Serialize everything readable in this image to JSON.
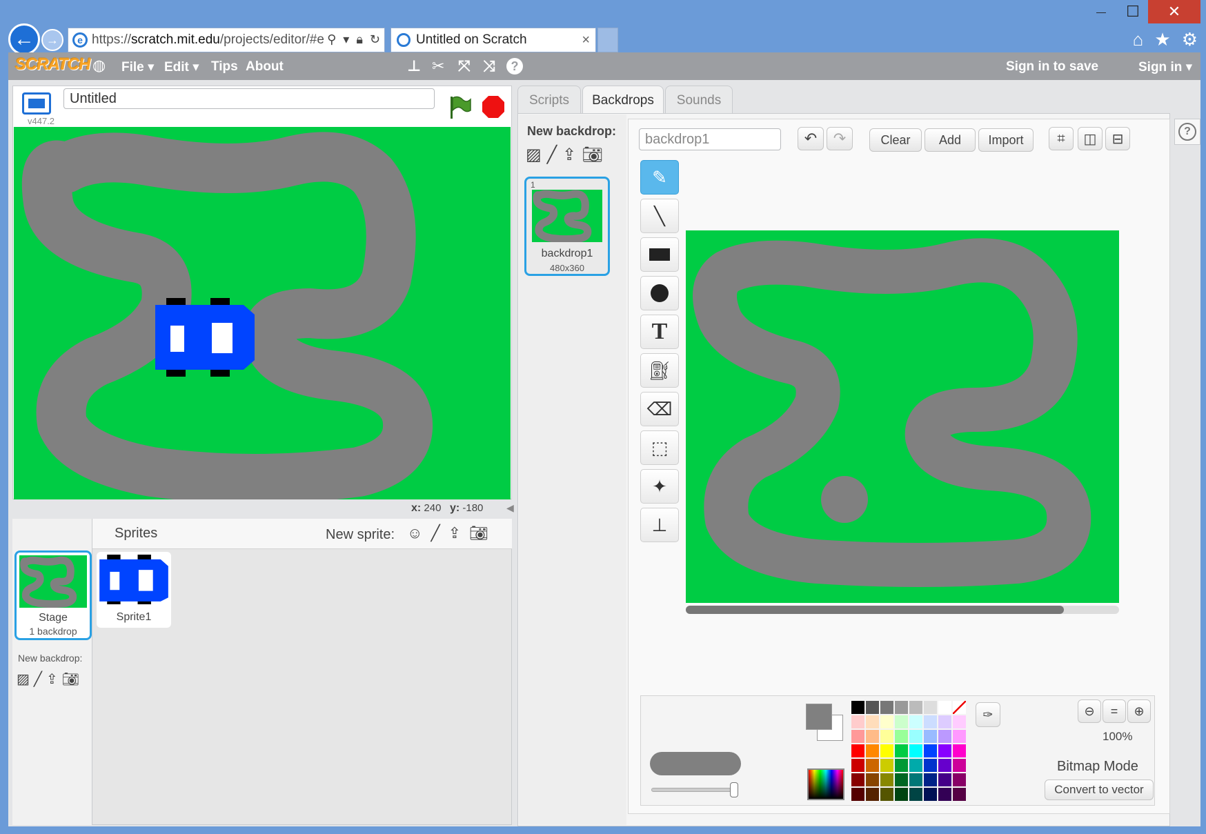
{
  "browser": {
    "url": "https://scratch.mit.edu/projects/editor/#e",
    "url_domain": "scratch.mit.edu",
    "url_prefix": "https://",
    "url_suffix": "/projects/editor/#e",
    "tab_title": "Untitled on Scratch",
    "tab_close": "×",
    "window_minimize": "—",
    "window_maximize": "☐",
    "window_close": "✕"
  },
  "menubar": {
    "logo": "SCRATCH",
    "file": "File ▾",
    "edit": "Edit ▾",
    "tips": "Tips",
    "about": "About",
    "sign_in_to_save": "Sign in to save",
    "sign_in": "Sign in ▾"
  },
  "stage": {
    "project_title": "Untitled",
    "version": "v447.2",
    "x_label": "x:",
    "x_value": "240",
    "y_label": "y:",
    "y_value": "-180"
  },
  "sprites": {
    "header": "Sprites",
    "new_sprite_label": "New sprite:",
    "stage_name": "Stage",
    "stage_backdrops": "1 backdrop",
    "new_backdrop_label": "New backdrop:",
    "items": [
      {
        "name": "Sprite1"
      }
    ]
  },
  "tabs": [
    {
      "label": "Scripts",
      "active": false
    },
    {
      "label": "Backdrops",
      "active": true
    },
    {
      "label": "Sounds",
      "active": false
    }
  ],
  "backdrops": {
    "new_backdrop_label": "New backdrop:",
    "items": [
      {
        "index": "1",
        "name": "backdrop1",
        "size": "480x360"
      }
    ]
  },
  "editor": {
    "name_value": "backdrop1",
    "clear": "Clear",
    "add": "Add",
    "import": "Import",
    "text_tool_glyph": "T",
    "zoom": "100%",
    "mode": "Bitmap Mode",
    "convert": "Convert to vector",
    "help": "?"
  },
  "colors": {
    "stage_green": "#00cc44",
    "track_gray": "#808080",
    "car_blue": "#0044ff",
    "selection_blue": "#2aa1e4",
    "menubar_gray": "#9c9ea2"
  },
  "palette": [
    "#000000",
    "#555555",
    "#777777",
    "#999999",
    "#bbbbbb",
    "#dddddd",
    "#ffffff",
    "none",
    "#ffcccc",
    "#ffddbb",
    "#ffffcc",
    "#ccffcc",
    "#ccffff",
    "#ccddff",
    "#ddccff",
    "#ffccff",
    "#ff9999",
    "#ffbb88",
    "#ffff99",
    "#99ff99",
    "#99ffff",
    "#99bbff",
    "#bb99ff",
    "#ff99ff",
    "#ff0000",
    "#ff8800",
    "#ffff00",
    "#00cc44",
    "#00ffff",
    "#0044ff",
    "#8800ff",
    "#ff00cc",
    "#cc0000",
    "#cc6600",
    "#cccc00",
    "#009933",
    "#00aaaa",
    "#0033cc",
    "#6600cc",
    "#cc0099",
    "#880000",
    "#884400",
    "#888800",
    "#006622",
    "#007777",
    "#002288",
    "#440088",
    "#880066",
    "#550000",
    "#552200",
    "#555500",
    "#004411",
    "#004444",
    "#001155",
    "#330055",
    "#550044"
  ]
}
